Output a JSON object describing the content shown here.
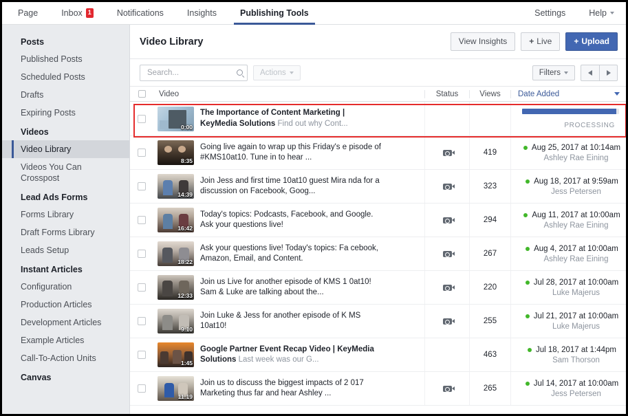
{
  "topnav": {
    "items": [
      {
        "label": "Page",
        "badge": null,
        "active": false
      },
      {
        "label": "Inbox",
        "badge": "1",
        "active": false
      },
      {
        "label": "Notifications",
        "badge": null,
        "active": false
      },
      {
        "label": "Insights",
        "badge": null,
        "active": false
      },
      {
        "label": "Publishing Tools",
        "badge": null,
        "active": true
      }
    ],
    "right": [
      {
        "label": "Settings",
        "caret": false
      },
      {
        "label": "Help",
        "caret": true
      }
    ]
  },
  "sidebar": {
    "groups": [
      {
        "title": "Posts",
        "items": [
          {
            "label": "Published Posts",
            "selected": false
          },
          {
            "label": "Scheduled Posts",
            "selected": false
          },
          {
            "label": "Drafts",
            "selected": false
          },
          {
            "label": "Expiring Posts",
            "selected": false
          }
        ]
      },
      {
        "title": "Videos",
        "items": [
          {
            "label": "Video Library",
            "selected": true
          },
          {
            "label": "Videos You Can Crosspost",
            "selected": false
          }
        ]
      },
      {
        "title": "Lead Ads Forms",
        "items": [
          {
            "label": "Forms Library",
            "selected": false
          },
          {
            "label": "Draft Forms Library",
            "selected": false
          },
          {
            "label": "Leads Setup",
            "selected": false
          }
        ]
      },
      {
        "title": "Instant Articles",
        "items": [
          {
            "label": "Configuration",
            "selected": false
          },
          {
            "label": "Production Articles",
            "selected": false
          },
          {
            "label": "Development Articles",
            "selected": false
          },
          {
            "label": "Example Articles",
            "selected": false
          },
          {
            "label": "Call-To-Action Units",
            "selected": false
          }
        ]
      },
      {
        "title": "Canvas",
        "items": []
      }
    ]
  },
  "panel": {
    "title": "Video Library",
    "view_insights_label": "View Insights",
    "live_label": "Live",
    "live_plus": "+",
    "upload_label": "Upload",
    "upload_plus": "+"
  },
  "toolbar": {
    "search_placeholder": "Search...",
    "search_value": "",
    "actions_label": "Actions",
    "filters_label": "Filters"
  },
  "table": {
    "headers": {
      "video": "Video",
      "status": "Status",
      "views": "Views",
      "date_added": "Date Added"
    },
    "rows": [
      {
        "title_strong": "The Importance of Content Marketing | KeyMedia Solutions",
        "title_dim": "Find out why Cont...",
        "duration": "0:00",
        "has_camera_icon": false,
        "views": "",
        "date": "",
        "author": "",
        "processing": true,
        "progress_percent": 97,
        "processing_label": "PROCESSING",
        "thumb_colors": [
          "#b9cedd",
          "#8fb3cc",
          "#5d6d78"
        ]
      },
      {
        "title_strong": "",
        "title_dim": "Going live again to wrap up this Friday's episode of #KMS10at10. Tune in to hear ...",
        "title_plain": "Going live again to wrap up this Friday's e pisode of #KMS10at10. Tune in to hear ...",
        "duration": "8:35",
        "has_camera_icon": true,
        "views": "419",
        "date": "Aug 25, 2017 at 10:14am",
        "author": "Ashley Rae Eining",
        "processing": false,
        "thumb_colors": [
          "#6d5c4c",
          "#3b3028",
          "#171310"
        ]
      },
      {
        "title_plain": "Join Jess and first time 10at10 guest Mira nda for a discussion on Facebook, Goog...",
        "duration": "14:39",
        "has_camera_icon": true,
        "views": "323",
        "date": "Aug 18, 2017 at 9:59am",
        "author": "Jess Petersen",
        "processing": false,
        "thumb_colors": [
          "#d6cfc6",
          "#6f7f92",
          "#3a3c40"
        ]
      },
      {
        "title_plain": "Today's topics: Podcasts, Facebook, and Google. Ask your questions live!",
        "duration": "16:42",
        "has_camera_icon": true,
        "views": "294",
        "date": "Aug 11, 2017 at 10:00am",
        "author": "Ashley Rae Eining",
        "processing": false,
        "thumb_colors": [
          "#cfc6bd",
          "#5d7fa3",
          "#50352f"
        ]
      },
      {
        "title_plain": "Ask your questions live! Today's topics: Fa cebook, Amazon, Email, and Content.",
        "duration": "18:22",
        "has_camera_icon": true,
        "views": "267",
        "date": "Aug 4, 2017 at 10:00am",
        "author": "Ashley Rae Eining",
        "processing": false,
        "thumb_colors": [
          "#ded5cc",
          "#6a7d96",
          "#3f3834"
        ]
      },
      {
        "title_plain": "Join us Live for another episode of KMS 1 0at10! Sam & Luke are talking about the...",
        "duration": "12:33",
        "has_camera_icon": true,
        "views": "220",
        "date": "Jul 28, 2017 at 10:00am",
        "author": "Luke Majerus",
        "processing": false,
        "thumb_colors": [
          "#c9c2b9",
          "#6c6359",
          "#2e2a26"
        ]
      },
      {
        "title_plain": "Join Luke & Jess for another episode of K MS 10at10!",
        "duration": "9:10",
        "has_camera_icon": true,
        "views": "255",
        "date": "Jul 21, 2017 at 10:00am",
        "author": "Luke Majerus",
        "processing": false,
        "thumb_colors": [
          "#d8d2ca",
          "#8c8b85",
          "#3c3a36"
        ]
      },
      {
        "title_strong": "Google Partner Event Recap Video | KeyMedia Solutions",
        "title_dim": "Last week was our G...",
        "duration": "1:45",
        "has_camera_icon": false,
        "views": "463",
        "date": "Jul 18, 2017 at 1:44pm",
        "author": "Sam Thorson",
        "processing": false,
        "thumb_colors": [
          "#e07a22",
          "#8a5a33",
          "#2f2723"
        ]
      },
      {
        "title_plain": "Join us to discuss the biggest impacts of 2 017 Marketing thus far and hear Ashley ...",
        "duration": "11:19",
        "has_camera_icon": true,
        "views": "265",
        "date": "Jul 14, 2017 at 10:00am",
        "author": "Jess Petersen",
        "processing": false,
        "thumb_colors": [
          "#dedacf",
          "#2f5ba8",
          "#554a42"
        ]
      }
    ]
  },
  "colors": {
    "accent": "#4267b2",
    "badge": "#e2282f",
    "online_dot": "#42b72a",
    "highlight_box": "#e52c2c",
    "sidebar_bg": "#e9ebee"
  }
}
